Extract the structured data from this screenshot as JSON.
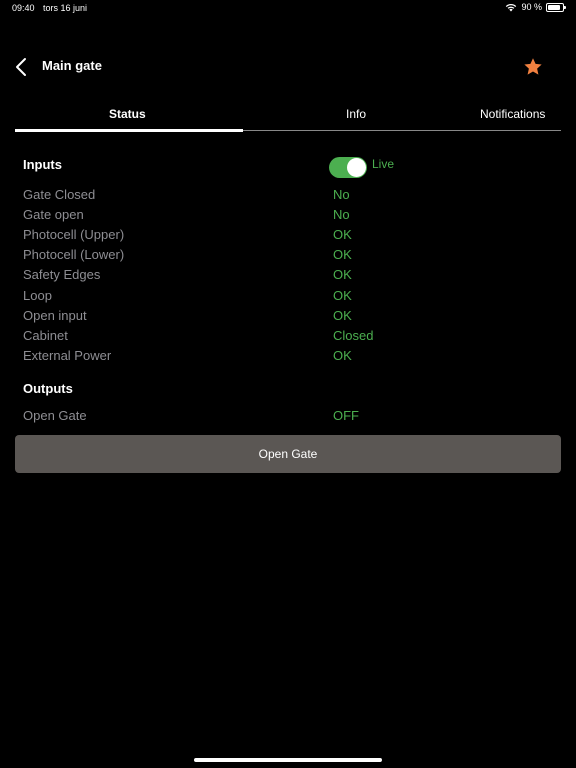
{
  "statusbar": {
    "time": "09:40",
    "date": "tors 16 juni",
    "battery": "90 %"
  },
  "header": {
    "title": "Main gate",
    "back_icon": "chevron-left-icon",
    "favorite_icon": "star-icon",
    "favorite_color": "#f08040"
  },
  "tabs": [
    {
      "label": "Status",
      "active": true
    },
    {
      "label": "Info",
      "active": false
    },
    {
      "label": "Notifications",
      "active": false
    }
  ],
  "inputs": {
    "title": "Inputs",
    "live_label": "Live",
    "live_enabled": true,
    "rows": [
      {
        "label": "Gate Closed",
        "value": "No"
      },
      {
        "label": "Gate open",
        "value": "No"
      },
      {
        "label": "Photocell (Upper)",
        "value": "OK"
      },
      {
        "label": "Photocell (Lower)",
        "value": "OK"
      },
      {
        "label": "Safety Edges",
        "value": "OK"
      },
      {
        "label": "Loop",
        "value": "OK"
      },
      {
        "label": "Open input",
        "value": "OK"
      },
      {
        "label": "Cabinet",
        "value": "Closed"
      },
      {
        "label": "External Power",
        "value": "OK"
      }
    ]
  },
  "outputs": {
    "title": "Outputs",
    "rows": [
      {
        "label": "Open Gate",
        "value": "OFF"
      }
    ]
  },
  "actions": {
    "open_gate_label": "Open Gate"
  },
  "colors": {
    "accent_green": "#4caf50",
    "label_gray": "#8e8e93",
    "button_bg": "#5b5754"
  }
}
